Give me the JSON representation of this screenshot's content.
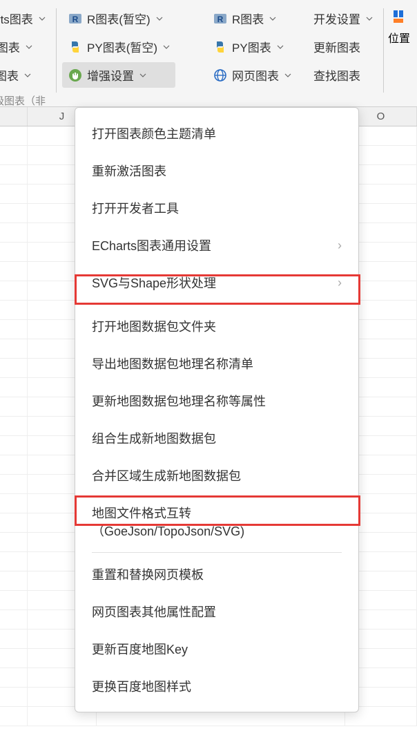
{
  "ribbon": {
    "group1": {
      "btn1": "harts图表",
      "btn2": "ga图表",
      "btn3": "地图表",
      "label": "高级图表（非"
    },
    "group2": {
      "btn1": "R图表(暂空)",
      "btn2": "PY图表(暂空)",
      "btn3": "增强设置"
    },
    "group3": {
      "btn1": "R图表",
      "btn2": "PY图表",
      "btn3": "网页图表"
    },
    "group4": {
      "btn1": "开发设置",
      "btn2": "更新图表",
      "btn3": "查找图表"
    },
    "right": {
      "label": "位置"
    }
  },
  "columns": [
    "J",
    "O"
  ],
  "menu": {
    "items": [
      "打开图表颜色主题清单",
      "重新激活图表",
      "打开开发者工具",
      "ECharts图表通用设置",
      "SVG与Shape形状处理",
      "打开地图数据包文件夹",
      "导出地图数据包地理名称清单",
      "更新地图数据包地理名称等属性",
      "组合生成新地图数据包",
      "合并区域生成新地图数据包",
      "地图文件格式互转（GoeJson/TopoJson/SVG)",
      "重置和替换网页模板",
      "网页图表其他属性配置",
      "更新百度地图Key",
      "更换百度地图样式"
    ]
  }
}
